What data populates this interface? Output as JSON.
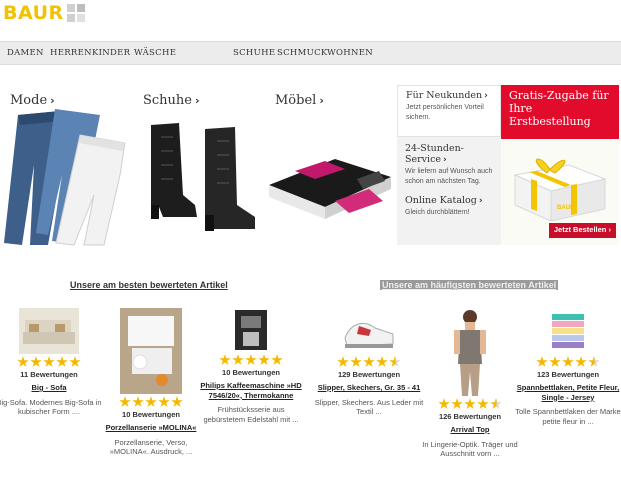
{
  "header": {
    "logo_text": "BAUR"
  },
  "nav": {
    "items": [
      "DAMEN",
      "HERREN",
      "KINDER",
      "WÄSCHE",
      "SCHUHE",
      "SCHMUCK",
      "WOHNEN"
    ]
  },
  "categories": [
    {
      "title": "Mode"
    },
    {
      "title": "Schuhe"
    },
    {
      "title": "Möbel"
    }
  ],
  "promo": {
    "neukunden_title": "Für Neukunden",
    "neukunden_text": "Jetzt persönlichen Vorteil sichern.",
    "service_title": "24-Stunden-Service",
    "service_text": "Wir liefern auf Wunsch auch schon am nächsten Tag.",
    "katalog_title": "Online Katalog",
    "katalog_text": "Gleich durchblättern!",
    "gift_title": "Gratis-Zugabe für Ihre Erstbestellung",
    "gift_box_brand": "BAUR",
    "cta_label": "Jetzt Bestellen"
  },
  "sections": {
    "best_rated": "Unsere am besten bewerteten Artikel",
    "most_rated": "Unsere am häufigsten bewerteten Artikel"
  },
  "products": [
    {
      "rating": 5,
      "reviews": "11 Bewertungen",
      "name": "Big - Sofa",
      "desc": "Big-Sofa. Modernes Big-Sofa in kubischer Form ...."
    },
    {
      "rating": 5,
      "reviews": "10 Bewertungen",
      "name": "Porzellanserie »MOLINA«",
      "desc": "Porzellanserie, Verso, »MOLINA«. Ausdruck, ..."
    },
    {
      "rating": 5,
      "reviews": "10 Bewertungen",
      "name": "Philips Kaffeemaschine »HD 7546/20«, Thermokanne",
      "desc": "Frühstücksserie aus gebürstetem Edelstahl mit ..."
    },
    {
      "rating": 4.5,
      "reviews": "129 Bewertungen",
      "name": "Slipper, Skechers, Gr. 35 - 41",
      "desc": "Slipper, Skechers. Aus Leder mit Textil ..."
    },
    {
      "rating": 4.5,
      "reviews": "126 Bewertungen",
      "name": "Arrival Top",
      "desc": "In Lingerie-Optik. Träger und Ausschnitt vorn ..."
    },
    {
      "rating": 4.5,
      "reviews": "123 Bewertungen",
      "name": "Spannbettlaken, Petite Fleur, Single - Jersey",
      "desc": "Tolle Spannbettlaken der Marke petite fleur in ..."
    }
  ]
}
